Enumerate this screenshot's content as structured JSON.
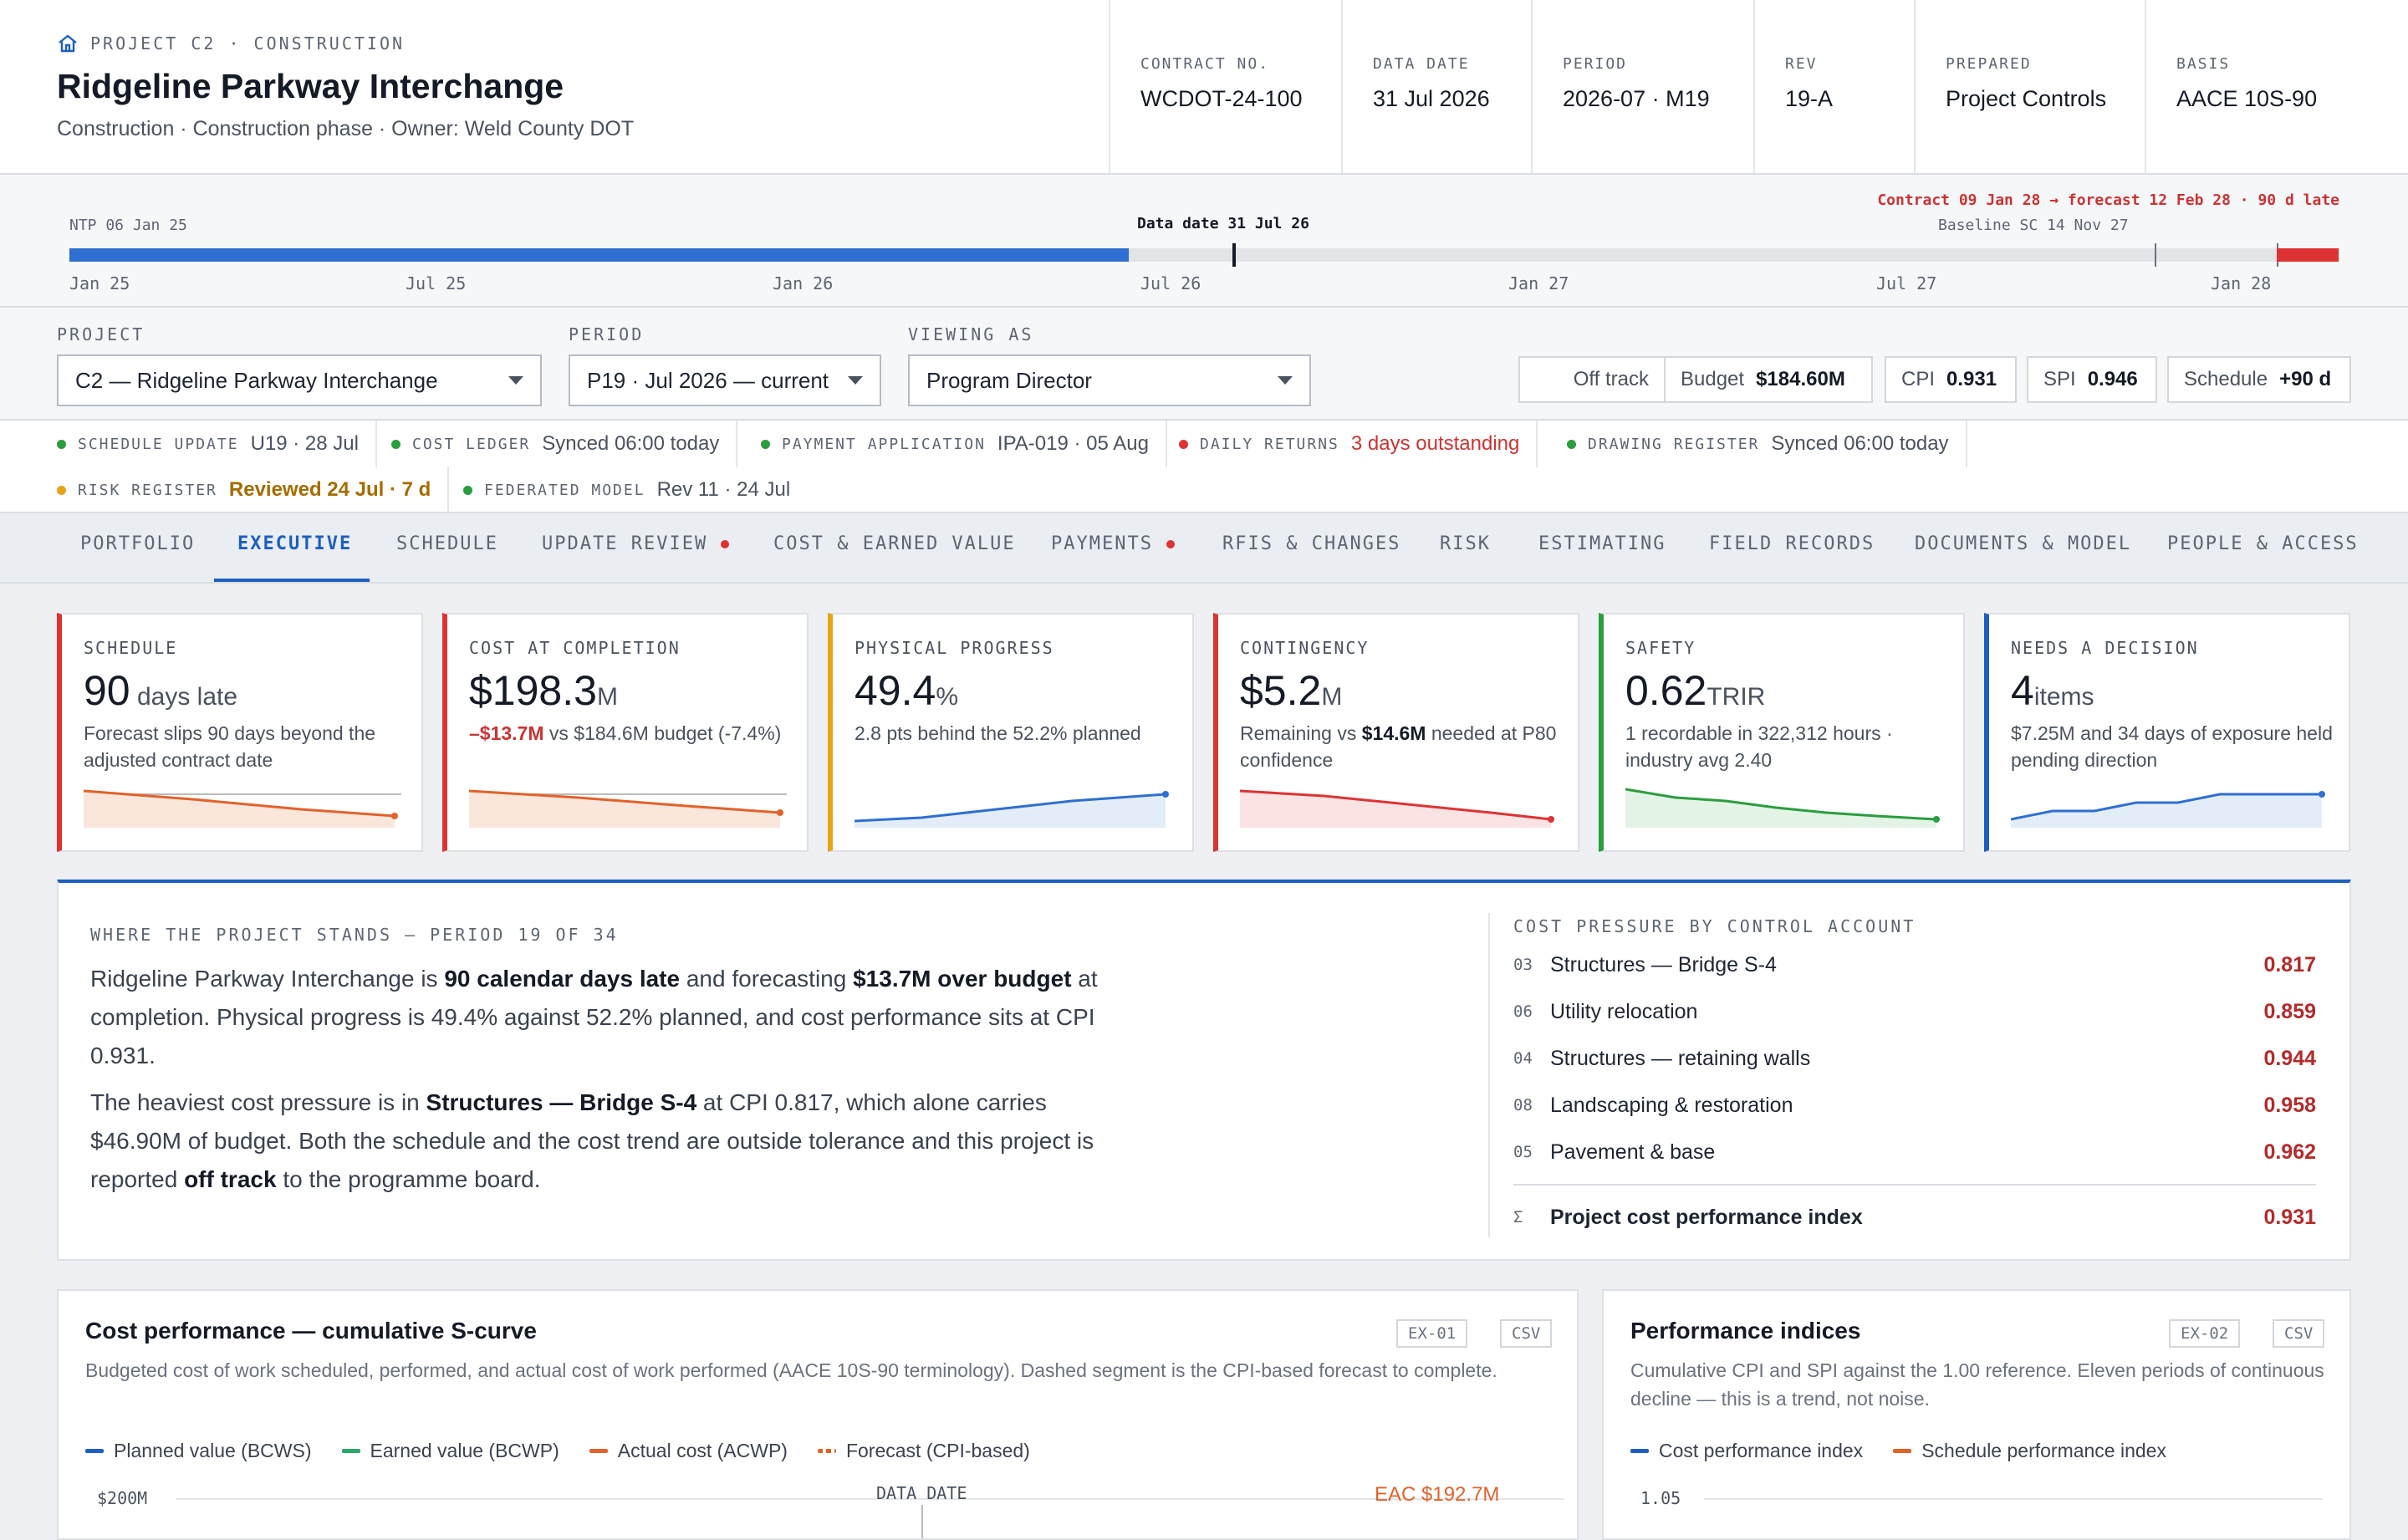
{
  "header": {
    "eyebrow": "PROJECT C2 · CONSTRUCTION",
    "title": "Ridgeline Parkway Interchange",
    "subtitle": "Construction · Construction phase · Owner: Weld County DOT",
    "meta": [
      {
        "k": "CONTRACT NO.",
        "v": "WCDOT-24-100"
      },
      {
        "k": "DATA DATE",
        "v": "31 Jul 2026"
      },
      {
        "k": "PERIOD",
        "v": "2026-07 · M19"
      },
      {
        "k": "REV",
        "v": "19-A"
      },
      {
        "k": "PREPARED",
        "v": "Project Controls"
      },
      {
        "k": "BASIS",
        "v": "AACE 10S-90"
      }
    ]
  },
  "timeline": {
    "ntp": "NTP 06 Jan 25",
    "datadate": "Data date 31 Jul 26",
    "baseline": "Baseline SC 14 Nov 27",
    "contract": "Contract 09 Jan 28 → forecast 12 Feb 28 · 90 d late",
    "progress_fraction": 0.4665,
    "ticks": [
      "Jan 25",
      "Jul 25",
      "Jan 26",
      "Jul 26",
      "Jan 27",
      "Jul 27",
      "Jan 28"
    ]
  },
  "controls": {
    "project_label": "PROJECT",
    "project_value": "C2 — Ridgeline Parkway Interchange",
    "period_label": "PERIOD",
    "period_value": "P19 · Jul 2026 — current",
    "viewing_label": "VIEWING AS",
    "viewing_value": "Program Director",
    "status": "Off track",
    "budget_k": "Budget",
    "budget_v": "$184.60M",
    "cpi_k": "CPI",
    "cpi_v": "0.931",
    "spi_k": "SPI",
    "spi_v": "0.946",
    "sched_k": "Schedule",
    "sched_v": "+90 d"
  },
  "sync": [
    {
      "k": "SCHEDULE UPDATE",
      "v": "U19 · 28 Jul",
      "c": "#2a9d3f"
    },
    {
      "k": "COST LEDGER",
      "v": "Synced 06:00 today",
      "c": "#2a9d3f"
    },
    {
      "k": "PAYMENT APPLICATION",
      "v": "IPA-019 · 05 Aug",
      "c": "#2a9d3f"
    },
    {
      "k": "DAILY RETURNS",
      "v": "3 days outstanding",
      "c": "#d33"
    },
    {
      "k": "DRAWING REGISTER",
      "v": "Synced 06:00 today",
      "c": "#2a9d3f"
    },
    {
      "k": "RISK REGISTER",
      "v": "Reviewed 24 Jul · 7 d",
      "c": "#e8a317"
    },
    {
      "k": "FEDERATED MODEL",
      "v": "Rev 11 · 24 Jul",
      "c": "#2a9d3f"
    }
  ],
  "tabs": [
    "PORTFOLIO",
    "EXECUTIVE",
    "SCHEDULE",
    "UPDATE REVIEW",
    "COST & EARNED VALUE",
    "PAYMENTS",
    "RFIS & CHANGES",
    "RISK",
    "ESTIMATING",
    "FIELD RECORDS",
    "DOCUMENTS & MODEL",
    "PEOPLE & ACCESS"
  ],
  "kpis": [
    {
      "k": "SCHEDULE",
      "big": "90",
      "unit": " days late",
      "d": "Forecast slips 90 days beyond the adjusted contract date",
      "color": "#d33"
    },
    {
      "k": "COST AT COMPLETION",
      "big": "$198.3",
      "unit": "M",
      "d1": "–$13.7M",
      "d2": " vs $184.6M budget (-7.4%)",
      "color": "#d33"
    },
    {
      "k": "PHYSICAL PROGRESS",
      "big": "49.4",
      "unit": "%",
      "d": "2.8 pts behind the 52.2% planned",
      "color": "#e8a317"
    },
    {
      "k": "CONTINGENCY",
      "big": "$5.2",
      "unit": "M",
      "d1": "Remaining vs ",
      "d2": "$14.6M",
      "d3": " needed at P80 confidence",
      "color": "#d33"
    },
    {
      "k": "SAFETY",
      "big": "0.62",
      "unit": "TRIR",
      "d": "1 recordable in 322,312 hours · industry avg 2.40",
      "color": "#2a9d3f"
    },
    {
      "k": "NEEDS A DECISION",
      "big": "4",
      "unit": "items",
      "d": "$7.25M and 34 days of exposure held pending direction",
      "color": "#1d5fbf"
    }
  ],
  "stand": {
    "k": "WHERE THE PROJECT STANDS — PERIOD 19 OF 34",
    "p1a": "Ridgeline Parkway Interchange is ",
    "p1b": "90 calendar days late",
    "p1c": " and forecasting ",
    "p1d": "$13.7M over budget",
    "p1e": " at completion. Physical progress is 49.4% against 52.2% planned, and cost performance sits at CPI 0.931.",
    "p2a": "The heaviest cost pressure is in ",
    "p2b": "Structures — Bridge S-4",
    "p2c": " at CPI 0.817, which alone carries $46.90M of budget. Both the schedule and the cost trend are outside tolerance and this project is reported ",
    "p2d": "off track",
    "p2e": " to the programme board.",
    "ca_k": "COST PRESSURE BY CONTROL ACCOUNT",
    "accounts": [
      {
        "n": "03",
        "t": "Structures — Bridge S-4",
        "v": "0.817"
      },
      {
        "n": "06",
        "t": "Utility relocation",
        "v": "0.859"
      },
      {
        "n": "04",
        "t": "Structures — retaining walls",
        "v": "0.944"
      },
      {
        "n": "08",
        "t": "Landscaping & restoration",
        "v": "0.958"
      },
      {
        "n": "05",
        "t": "Pavement & base",
        "v": "0.962"
      }
    ],
    "total_n": "Σ",
    "total_t": "Project cost performance index",
    "total_v": "0.931"
  },
  "card1": {
    "title": "Cost performance — cumulative S-curve",
    "desc": "Budgeted cost of work scheduled, performed, and actual cost of work performed (AACE 10S-90 terminology). Dashed segment is the CPI-based forecast to complete.",
    "b1": "EX-01",
    "b2": "CSV",
    "legend": [
      {
        "t": "Planned value (BCWS)",
        "c": "#1d5fbf"
      },
      {
        "t": "Earned value (BCWP)",
        "c": "#2aa76a"
      },
      {
        "t": "Actual cost (ACWP)",
        "c": "#e2622a"
      },
      {
        "t": "Forecast (CPI-based)",
        "c": "#e2622a"
      }
    ],
    "y_top": "$200M",
    "dd": "DATA DATE",
    "eac": "EAC $192.7M"
  },
  "card2": {
    "title": "Performance indices",
    "desc": "Cumulative CPI and SPI against the 1.00 reference. Eleven periods of continuous decline — this is a trend, not noise.",
    "b1": "EX-02",
    "b2": "CSV",
    "legend": [
      {
        "t": "Cost performance index",
        "c": "#1d5fbf"
      },
      {
        "t": "Schedule performance index",
        "c": "#e2622a"
      }
    ],
    "y_top": "1.05"
  },
  "colors": {
    "accent": "#1d5fbf",
    "danger": "#d33",
    "warn": "#e8a317",
    "ok": "#2a9d3f"
  }
}
